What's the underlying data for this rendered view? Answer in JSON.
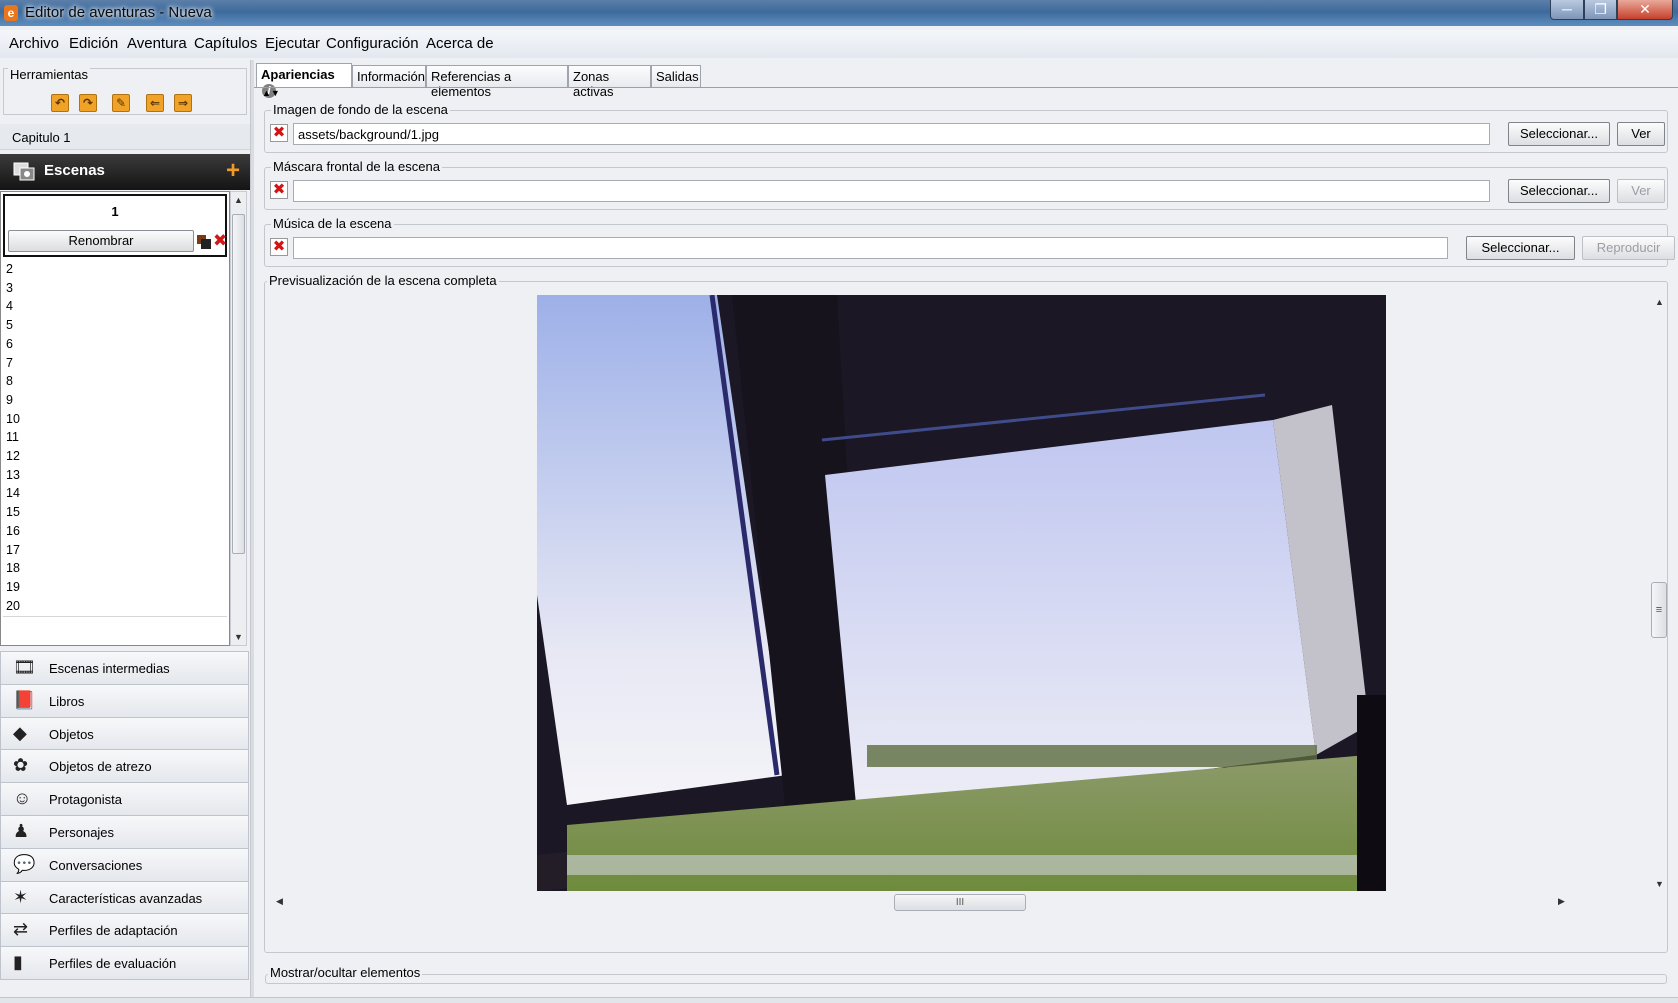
{
  "window": {
    "title": "Editor de aventuras - Nueva",
    "controls": {
      "minimize": "─",
      "maximize": "❐",
      "close": "✕"
    }
  },
  "menu": [
    "Archivo",
    "Edición",
    "Aventura",
    "Capítulos",
    "Ejecutar",
    "Configuración",
    "Acerca de"
  ],
  "tools": {
    "title": "Herramientas",
    "buttons": [
      {
        "icon": "undo-icon",
        "glyph": "↶"
      },
      {
        "icon": "redo-icon",
        "glyph": "↷"
      },
      {
        "icon": "validate-icon",
        "glyph": "✎"
      },
      {
        "icon": "back-icon",
        "glyph": "⇐"
      },
      {
        "icon": "forward-icon",
        "glyph": "⇒"
      }
    ]
  },
  "chapter": "Capitulo 1",
  "scenes": {
    "header": "Escenas",
    "add": "+",
    "selected": "1",
    "rename": "Renombrar",
    "delete": "✖",
    "rows": [
      "2",
      "3",
      "4",
      "5",
      "6",
      "7",
      "8",
      "9",
      "10",
      "11",
      "12",
      "13",
      "14",
      "15",
      "16",
      "17",
      "18",
      "19",
      "20"
    ]
  },
  "categories": [
    {
      "label": "Escenas intermedias",
      "icon": "cutscene-icon"
    },
    {
      "label": "Libros",
      "icon": "book-icon"
    },
    {
      "label": "Objetos",
      "icon": "objects-icon"
    },
    {
      "label": "Objetos de atrezo",
      "icon": "atrezzo-icon"
    },
    {
      "label": "Protagonista",
      "icon": "player-icon"
    },
    {
      "label": "Personajes",
      "icon": "characters-icon"
    },
    {
      "label": "Conversaciones",
      "icon": "conversations-icon"
    },
    {
      "label": "Características avanzadas",
      "icon": "advanced-icon"
    },
    {
      "label": "Perfiles de adaptación",
      "icon": "adaptation-icon"
    },
    {
      "label": "Perfiles de evaluación",
      "icon": "assessment-icon"
    }
  ],
  "tabs": [
    "Apariencias",
    "Información",
    "Referencias a elementos",
    "Zonas activas",
    "Salidas"
  ],
  "background": {
    "title": "Imagen de fondo de la escena",
    "value": "assets/background/1.jpg",
    "select": "Seleccionar...",
    "view": "Ver"
  },
  "foreground": {
    "title": "Máscara frontal de la escena",
    "value": "",
    "select": "Seleccionar...",
    "view": "Ver"
  },
  "music": {
    "title": "Música de la escena",
    "value": "",
    "select": "Seleccionar...",
    "play": "Reproducir"
  },
  "preview": {
    "title": "Previsualización de la escena completa",
    "toggle": "Mostrar/ocultar elementos",
    "hthumb": "III",
    "vthumb": "≡"
  },
  "colors": {
    "accent": "#f09a28",
    "delete_red": "#d21414"
  }
}
